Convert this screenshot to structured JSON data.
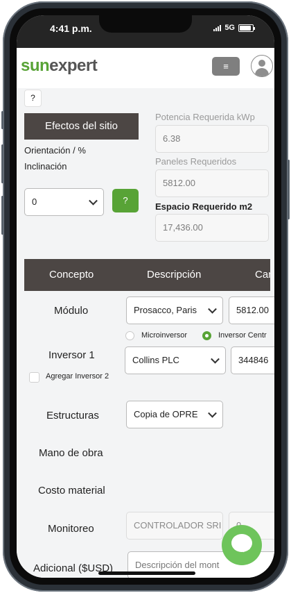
{
  "status_bar": {
    "time": "4:41 p.m.",
    "network": "5G"
  },
  "header": {
    "logo_part1": "sun",
    "logo_part2": "expert",
    "menu_icon": "≡"
  },
  "site": {
    "help_label": "?",
    "efectos_label": "Efectos del sitio",
    "orientacion_label": "Orientación / %",
    "inclinacion_label": "Inclinación",
    "inclinacion_value": "0",
    "inclinacion_help": "?"
  },
  "requirements": {
    "potencia_label": "Potencia Requerida kWp",
    "potencia_value": "6.38",
    "paneles_label": "Paneles Requeridos",
    "paneles_value": "5812.00",
    "espacio_label": "Espacio Requerido m2",
    "espacio_value": "17,436.00"
  },
  "table": {
    "headers": [
      "Concepto",
      "Descripción",
      "Can"
    ],
    "modulo": {
      "label": "Módulo",
      "description": "Prosacco, Paris",
      "quantity": "5812.00"
    },
    "inversor": {
      "label": "Inversor 1",
      "radio_micro": "Microinversor",
      "radio_central": "Inversor Centr",
      "description": "Collins PLC",
      "quantity": "344846",
      "add_label": "Agregar Inversor 2"
    },
    "estructuras": {
      "label": "Estructuras",
      "description": "Copia de OPRE"
    },
    "mano_obra": {
      "label": "Mano de obra"
    },
    "costo_material": {
      "label": "Costo material"
    },
    "monitoreo": {
      "label": "Monitoreo",
      "description": "CONTROLADOR SRI",
      "quantity": "0"
    },
    "adicional": {
      "label": "Adicional ($USD)",
      "placeholder": "Descripción del mont"
    }
  },
  "colors": {
    "brand_green": "#58a336",
    "header_dark": "#4c4644",
    "fab_green": "#6ec45b"
  }
}
